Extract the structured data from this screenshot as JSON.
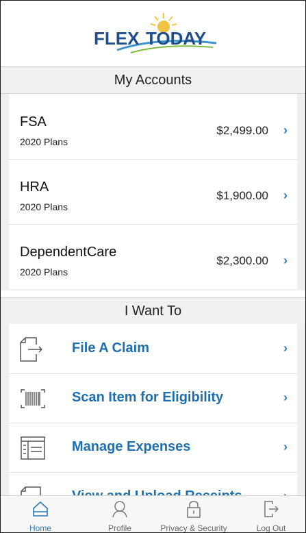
{
  "logo": {
    "part1": "FLEX",
    "part2": "TODAY"
  },
  "accounts_section": {
    "title": "My Accounts",
    "items": [
      {
        "name": "FSA",
        "plan": "2020 Plans",
        "amount": "$2,499.00",
        "chevron": "›"
      },
      {
        "name": "HRA",
        "plan": "2020 Plans",
        "amount": "$1,900.00",
        "chevron": "›"
      },
      {
        "name": "DependentCare",
        "plan": "2020 Plans",
        "amount": "$2,300.00",
        "chevron": "›"
      }
    ]
  },
  "actions_section": {
    "title": "I Want To",
    "items": [
      {
        "label": "File A Claim",
        "icon": "file-claim-icon",
        "chevron": "›"
      },
      {
        "label": "Scan Item for Eligibility",
        "icon": "barcode-scan-icon",
        "chevron": "›"
      },
      {
        "label": "Manage Expenses",
        "icon": "manage-expenses-icon",
        "chevron": "›"
      },
      {
        "label": "View and Upload Receipts",
        "icon": "receipt-icon",
        "chevron": "›"
      }
    ]
  },
  "tabbar": {
    "tabs": [
      {
        "label": "Home",
        "icon": "home-icon",
        "active": true
      },
      {
        "label": "Profile",
        "icon": "profile-icon",
        "active": false
      },
      {
        "label": "Privacy & Security",
        "icon": "lock-icon",
        "active": false
      },
      {
        "label": "Log Out",
        "icon": "logout-icon",
        "active": false
      }
    ]
  },
  "colors": {
    "accent": "#2a7ab8",
    "action_text": "#1f6fae",
    "logo_blue": "#1f4e8c",
    "sun": "#f2c443",
    "section_bg": "#efefef"
  }
}
